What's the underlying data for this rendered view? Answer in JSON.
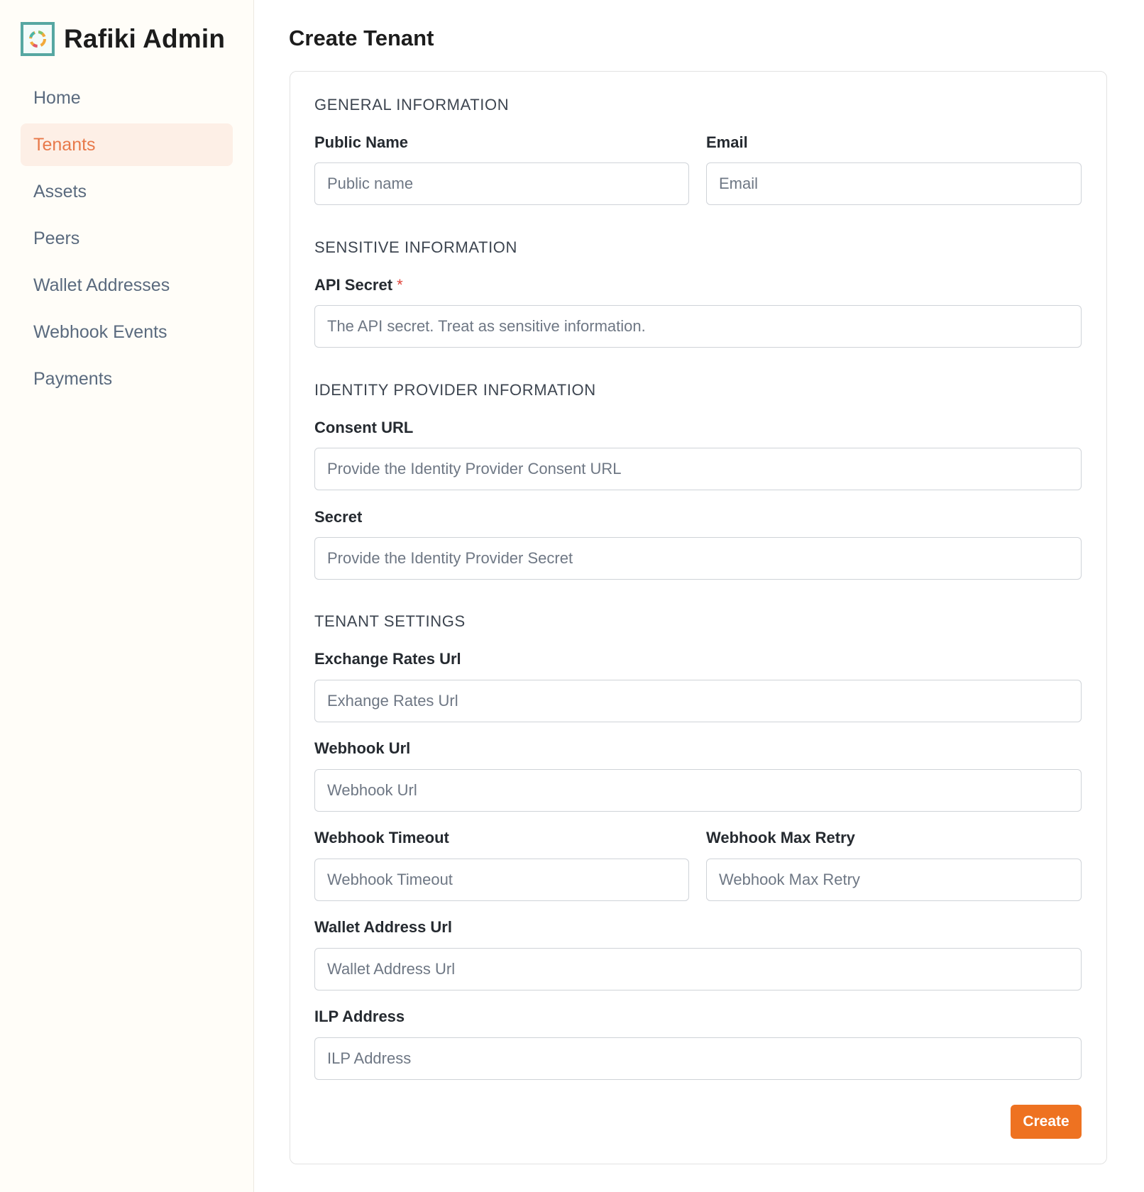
{
  "brand": {
    "title": "Rafiki Admin",
    "logo_icon": "rafiki-ring-logo-icon",
    "logo_border_color": "#56a7a2"
  },
  "sidebar": {
    "items": [
      {
        "label": "Home",
        "active": false
      },
      {
        "label": "Tenants",
        "active": true
      },
      {
        "label": "Assets",
        "active": false
      },
      {
        "label": "Peers",
        "active": false
      },
      {
        "label": "Wallet Addresses",
        "active": false
      },
      {
        "label": "Webhook Events",
        "active": false
      },
      {
        "label": "Payments",
        "active": false
      }
    ],
    "active_color": "#e8794a",
    "active_background": "#fdefe6"
  },
  "page": {
    "title": "Create Tenant"
  },
  "form": {
    "general": {
      "heading": "GENERAL INFORMATION",
      "public_name": {
        "label": "Public Name",
        "placeholder": "Public name",
        "value": ""
      },
      "email": {
        "label": "Email",
        "placeholder": "Email",
        "value": ""
      }
    },
    "sensitive": {
      "heading": "SENSITIVE INFORMATION",
      "api_secret": {
        "label": "API Secret",
        "required_mark": "*",
        "placeholder": "The API secret. Treat as sensitive information.",
        "value": ""
      }
    },
    "identity": {
      "heading": "IDENTITY PROVIDER INFORMATION",
      "consent_url": {
        "label": "Consent URL",
        "placeholder": "Provide the Identity Provider Consent URL",
        "value": ""
      },
      "secret": {
        "label": "Secret",
        "placeholder": "Provide the Identity Provider Secret",
        "value": ""
      }
    },
    "settings": {
      "heading": "TENANT SETTINGS",
      "exchange_rates_url": {
        "label": "Exchange Rates Url",
        "placeholder": "Exhange Rates Url",
        "value": ""
      },
      "webhook_url": {
        "label": "Webhook Url",
        "placeholder": "Webhook Url",
        "value": ""
      },
      "webhook_timeout": {
        "label": "Webhook Timeout",
        "placeholder": "Webhook Timeout",
        "value": ""
      },
      "webhook_max_retry": {
        "label": "Webhook Max Retry",
        "placeholder": "Webhook Max Retry",
        "value": ""
      },
      "wallet_address_url": {
        "label": "Wallet Address Url",
        "placeholder": "Wallet Address Url",
        "value": ""
      },
      "ilp_address": {
        "label": "ILP Address",
        "placeholder": "ILP Address",
        "value": ""
      }
    },
    "create_label": "Create",
    "create_color": "#ee7221"
  }
}
